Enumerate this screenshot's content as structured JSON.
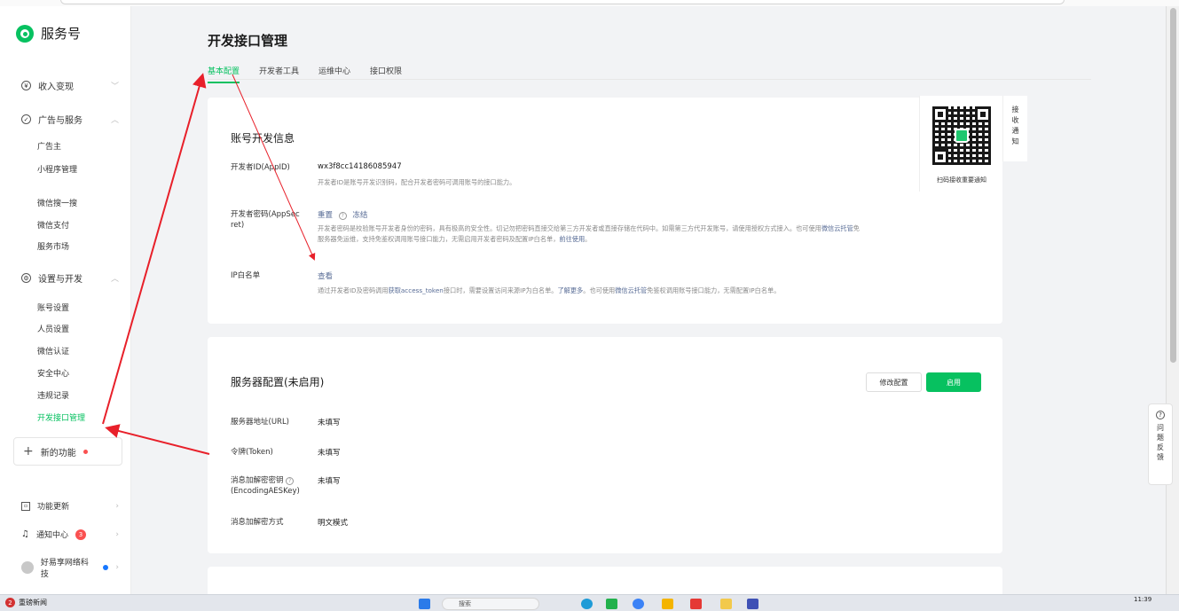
{
  "sidebar": {
    "brand": "服务号",
    "groups": {
      "income": "收入变现",
      "ads": "广告与服务",
      "settings": "设置与开发"
    },
    "ads_items": [
      "广告主",
      "小程序管理",
      "微信搜一搜",
      "微信支付",
      "服务市场"
    ],
    "settings_items": [
      "账号设置",
      "人员设置",
      "微信认证",
      "安全中心",
      "违规记录",
      "开发接口管理"
    ],
    "new_features": "新的功能",
    "bottom": {
      "updates": "功能更新",
      "notify_center": "通知中心",
      "notify_count": "3",
      "account": "好易享网络科技"
    }
  },
  "main": {
    "page_title": "开发接口管理",
    "tabs": [
      "基本配置",
      "开发者工具",
      "运维中心",
      "接口权限"
    ],
    "account_card": {
      "title": "账号开发信息",
      "appid_label": "开发者ID(AppID)",
      "appid_value": "wx3f8cc14186085947",
      "appid_desc": "开发者ID是账号开发识别码，配合开发者密码可调用账号的接口能力。",
      "secret_label_1": "开发者密码(AppSec",
      "secret_label_2": "ret)",
      "secret_reset": "重置",
      "secret_freeze": "冻结",
      "secret_desc_1a": "开发者密码是校验账号开发者身份的密码，具有极高的安全性。切记勿把密码直接交给第三方开发者或直接存储在代码中。如需第三方代开发账号，请使用授权方式接入。也可使用",
      "secret_desc_1b": "微信云托管",
      "secret_desc_1c": "免",
      "secret_desc_2a": "服务器免运维，支持免鉴权调用账号接口能力，无需启用开发者密码及配置IP白名单，",
      "secret_desc_2b": "前往使用",
      "ip_label": "IP白名单",
      "ip_value": "查看",
      "ip_desc_a": "通过开发者ID及密码调用",
      "ip_desc_b": "获取access_token",
      "ip_desc_c": "接口时，需要设置访问来源IP为白名单。",
      "ip_desc_d": "了解更多",
      "ip_desc_e": "也可使用",
      "ip_desc_f": "微信云托管",
      "ip_desc_g": "免鉴权调用账号接口能力，无需配置IP白名单。"
    },
    "qr": {
      "caption": "扫码接收重要通知",
      "side_label": [
        "接",
        "收",
        "通",
        "知"
      ]
    },
    "server_card": {
      "title": "服务器配置(未启用)",
      "edit_button": "修改配置",
      "enable_button": "启用",
      "rows": [
        {
          "label": "服务器地址(URL)",
          "value": "未填写"
        },
        {
          "label": "令牌(Token)",
          "value": "未填写"
        },
        {
          "label": "消息加解密密钥",
          "label2": "(EncodingAESKey)",
          "value": "未填写"
        },
        {
          "label": "消息加解密方式",
          "value": "明文模式"
        }
      ]
    }
  },
  "feedback": [
    "问",
    "题",
    "反",
    "馈"
  ],
  "taskbar": {
    "news": "重磅新闻",
    "news_badge": "2",
    "search": "搜索",
    "time": "11:39"
  },
  "colors": {
    "accent": "#07c160",
    "link": "#576b95",
    "arrow": "#e8202a"
  }
}
